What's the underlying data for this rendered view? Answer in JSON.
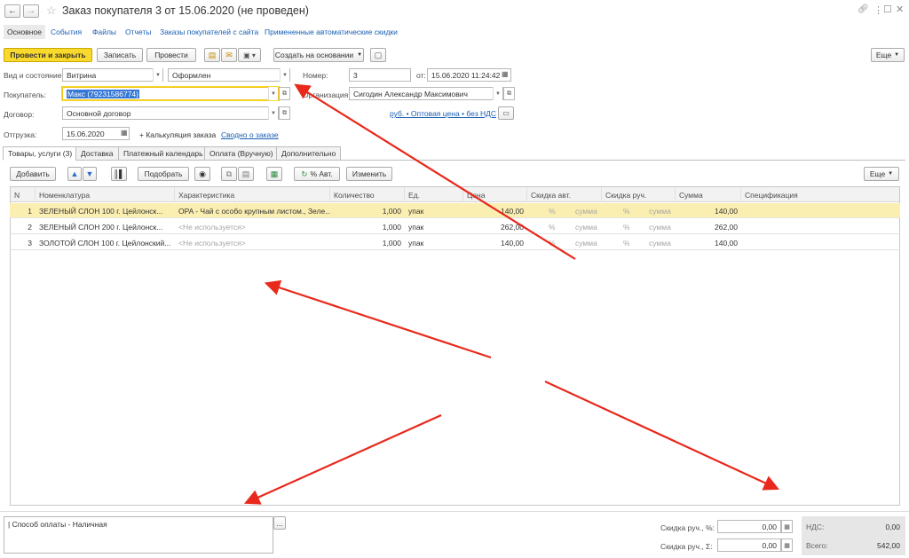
{
  "window": {
    "title": "Заказ покупателя 3 от 15.06.2020 (не проведен)",
    "nav_tabs": [
      "Основное",
      "События",
      "Файлы",
      "Отчеты",
      "Заказы покупателей с сайта",
      "Примененные автоматические скидки"
    ]
  },
  "toolbar": {
    "post_close": "Провести и закрыть",
    "save": "Записать",
    "post": "Провести",
    "create_based": "Создать на основании",
    "more": "Еще"
  },
  "form": {
    "kind_label": "Вид и состояние:",
    "kind_value": "Витрина",
    "state_value": "Оформлен",
    "number_label": "Номер:",
    "number_value": "3",
    "from_label": "от:",
    "date_value": "15.06.2020 11:24:42",
    "buyer_label": "Покупатель:",
    "buyer_value": "Макс (79231586774)",
    "org_label": "Организация:",
    "org_value": "Сигодин Александр Максимович",
    "contract_label": "Договор:",
    "contract_value": "Основной договор",
    "price_link": "руб. • Оптовая цена • без НДС",
    "shipment_label": "Отгрузка:",
    "shipment_value": "15.06.2020",
    "calc_link": "+ Калькуляция заказа",
    "summary_link": "Сводно о заказе"
  },
  "tabs": [
    "Товары, услуги (3)",
    "Доставка",
    "Платежный календарь",
    "Оплата (Вручную)",
    "Дополнительно"
  ],
  "table_toolbar": {
    "add": "Добавить",
    "pick": "Подобрать",
    "auto": "% Авт.",
    "change": "Изменить",
    "more": "Еще"
  },
  "table": {
    "headers": [
      "N",
      "Номенклатура",
      "Характеристика",
      "Количество",
      "Ед.",
      "Цена",
      "Скидка авт.",
      "Скидка руч.",
      "Сумма",
      "Спецификация"
    ],
    "pct": "%",
    "sum": "сумма",
    "rows": [
      {
        "n": "1",
        "name": "ЗЕЛЕНЫЙ СЛОН 100 г. Цейлонск...",
        "char": "OPA - Чай с особо крупным листом., Зеле...",
        "qty": "1,000",
        "unit": "упак",
        "price": "140,00",
        "total": "140,00"
      },
      {
        "n": "2",
        "name": "ЗЕЛЕНЫЙ СЛОН 200 г. Цейлонск...",
        "char": "<Не используется>",
        "qty": "1,000",
        "unit": "упак",
        "price": "262,00",
        "total": "262,00"
      },
      {
        "n": "3",
        "name": "ЗОЛОТОЙ СЛОН 100 г. Цейлонский...",
        "char": "<Не используется>",
        "qty": "1,000",
        "unit": "упак",
        "price": "140,00",
        "total": "140,00"
      }
    ]
  },
  "footer": {
    "comment": "| Способ оплаты - Наличная",
    "comment_btn": "...",
    "disc_pct_label": "Скидка руч., %:",
    "disc_pct_value": "0,00",
    "disc_sum_label": "Скидка руч., Σ:",
    "disc_sum_value": "0,00",
    "vat_label": "НДС:",
    "vat_value": "0,00",
    "total_label": "Всего:",
    "total_value": "542,00"
  },
  "colors": {
    "accent_yellow": "#f9d92c",
    "selected_row": "#fbeeb1",
    "link_blue": "#1a5fb4",
    "annotation_red": "#e8291b"
  },
  "icons": [
    "back-arrow-icon",
    "forward-arrow-icon",
    "star-icon",
    "link-icon",
    "more-vertical-icon",
    "maximize-icon",
    "close-icon",
    "print-icon",
    "calendar-icon",
    "eye-icon",
    "copy-icon",
    "refresh-icon",
    "arrow-up-icon",
    "arrow-down-icon",
    "barcode-icon"
  ]
}
